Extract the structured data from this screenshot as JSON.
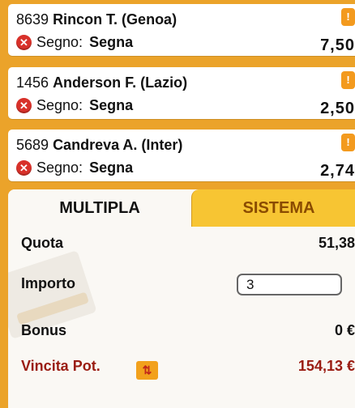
{
  "bets": [
    {
      "code": "8639",
      "player": "Rincon T. (Genoa)",
      "segno_label": "Segno:",
      "segno_value": "Segna",
      "odd": "7,50"
    },
    {
      "code": "1456",
      "player": "Anderson F. (Lazio)",
      "segno_label": "Segno:",
      "segno_value": "Segna",
      "odd": "2,50"
    },
    {
      "code": "5689",
      "player": "Candreva A. (Inter)",
      "segno_label": "Segno:",
      "segno_value": "Segna",
      "odd": "2,74"
    }
  ],
  "tabs": {
    "multipla": "MULTIPLA",
    "sistema": "SISTEMA"
  },
  "summary": {
    "quota_label": "Quota",
    "quota_value": "51,38",
    "importo_label": "Importo",
    "importo_value": "3",
    "currency": "€",
    "bonus_label": "Bonus",
    "bonus_value": "0 €",
    "vincita_label": "Vincita Pot.",
    "vincita_value": "154,13 €"
  },
  "icons": {
    "remove": "remove-icon",
    "info": "info-icon",
    "swap": "swap-arrows-icon"
  },
  "colors": {
    "background": "#eba32a",
    "accent_tab": "#f7c533",
    "win": "#9a1c12"
  }
}
